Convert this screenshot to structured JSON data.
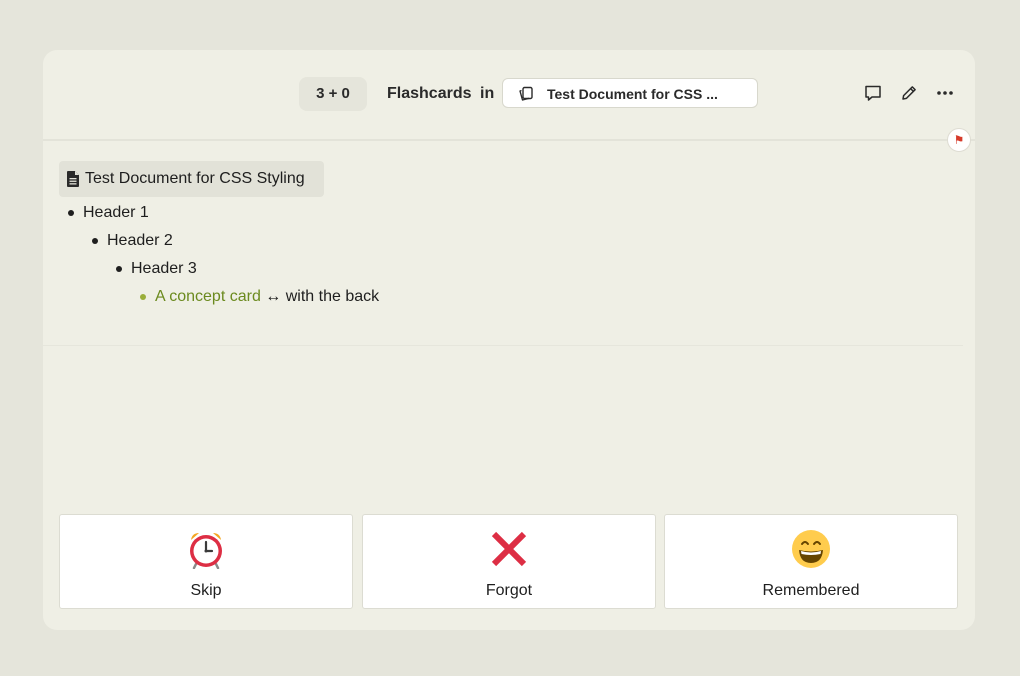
{
  "header": {
    "count_badge": "3 + 0",
    "title": "Flashcards",
    "in_word": "in",
    "doc_chip_label": "Test Document for CSS ...",
    "doc_chip_icon": "cards-icon",
    "actions": [
      "comment-icon",
      "edit-icon",
      "more-icon"
    ]
  },
  "flag_icon": "flag-icon",
  "document": {
    "title": "Test Document for CSS Styling",
    "icon": "file-icon"
  },
  "tree": {
    "header1": "Header 1",
    "header2": "Header 2",
    "header3": "Header 3",
    "card_front": "A concept card",
    "card_arrow": "↔",
    "card_back": "with the back"
  },
  "buttons": {
    "skip": {
      "label": "Skip",
      "icon": "alarm-clock-icon"
    },
    "forgot": {
      "label": "Forgot",
      "icon": "cross-mark-icon"
    },
    "remembered": {
      "label": "Remembered",
      "icon": "grinning-face-icon"
    }
  },
  "colors": {
    "background": "#e5e5db",
    "panel": "#efefe5",
    "concept_text": "#6b8a1e",
    "cross_red": "#dd2e44"
  }
}
